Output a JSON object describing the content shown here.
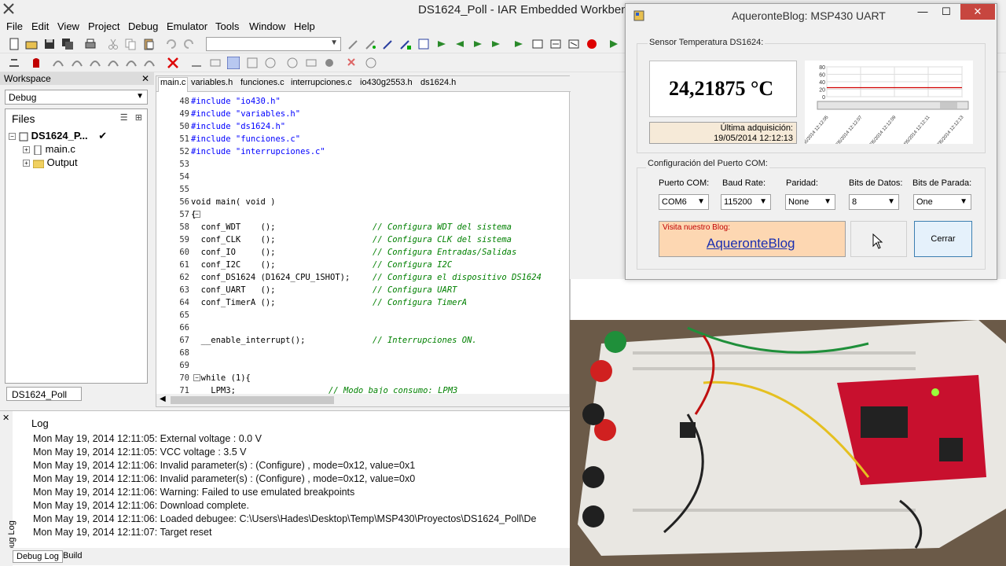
{
  "window": {
    "title": "DS1624_Poll - IAR Embedded Workbench"
  },
  "menu": [
    "File",
    "Edit",
    "View",
    "Project",
    "Debug",
    "Emulator",
    "Tools",
    "Window",
    "Help"
  ],
  "workspace": {
    "title": "Workspace",
    "config": "Debug",
    "files_header": "Files",
    "tree": [
      {
        "label": "DS1624_P...",
        "check": "✔"
      },
      {
        "label": "main.c"
      },
      {
        "label": "Output"
      }
    ],
    "bottom_tab": "DS1624_Poll"
  },
  "editor": {
    "tabs": [
      "main.c",
      "variables.h",
      "funciones.c",
      "interrupciones.c",
      "io430g2553.h",
      "ds1624.h"
    ],
    "lines": [
      {
        "n": "48",
        "t": "#include \"io430.h\""
      },
      {
        "n": "49",
        "t": "#include \"variables.h\""
      },
      {
        "n": "50",
        "t": "#include \"ds1624.h\""
      },
      {
        "n": "51",
        "t": "#include \"funciones.c\""
      },
      {
        "n": "52",
        "t": "#include \"interrupciones.c\""
      },
      {
        "n": "53",
        "t": ""
      },
      {
        "n": "54",
        "t": ""
      },
      {
        "n": "55",
        "t": ""
      },
      {
        "n": "56",
        "t": "void main( void )"
      },
      {
        "n": "57",
        "t": "{"
      },
      {
        "n": "58",
        "t": "  conf_WDT    ();",
        "c": "// Configura WDT del sistema"
      },
      {
        "n": "59",
        "t": "  conf_CLK    ();",
        "c": "// Configura CLK del sistema"
      },
      {
        "n": "60",
        "t": "  conf_IO     ();",
        "c": "// Configura Entradas/Salidas"
      },
      {
        "n": "61",
        "t": "  conf_I2C    ();",
        "c": "// Configura I2C"
      },
      {
        "n": "62",
        "t": "  conf_DS1624 (D1624_CPU_1SHOT);",
        "c": "// Configura el dispositivo DS1624"
      },
      {
        "n": "63",
        "t": "  conf_UART   ();",
        "c": "// Configura UART"
      },
      {
        "n": "64",
        "t": "  conf_TimerA ();",
        "c": "// Configura TimerA"
      },
      {
        "n": "65",
        "t": ""
      },
      {
        "n": "66",
        "t": ""
      },
      {
        "n": "67",
        "t": "  __enable_interrupt();",
        "c": "// Interrupciones ON."
      },
      {
        "n": "68",
        "t": ""
      },
      {
        "n": "69",
        "t": ""
      },
      {
        "n": "70",
        "t": "  while (1){"
      },
      {
        "n": "71",
        "t": "    LPM3;",
        "c": "// Modo bajo consumo: LPM3"
      }
    ]
  },
  "log": {
    "header": "Log",
    "side_label": "Debug Log",
    "lines": [
      "Mon May 19, 2014 12:11:05: External voltage : 0.0 V",
      "Mon May 19, 2014 12:11:05: VCC voltage : 3.5 V",
      "Mon May 19, 2014 12:11:06: Invalid parameter(s) : (Configure) , mode=0x12, value=0x1",
      "Mon May 19, 2014 12:11:06: Invalid parameter(s) : (Configure) , mode=0x12, value=0x0",
      "Mon May 19, 2014 12:11:06: Warning: Failed to use emulated breakpoints",
      "Mon May 19, 2014 12:11:06: Download complete.",
      "Mon May 19, 2014 12:11:06: Loaded debugee: C:\\Users\\Hades\\Desktop\\Temp\\MSP430\\Proyectos\\DS1624_Poll\\De",
      "Mon May 19, 2014 12:11:07: Target reset"
    ],
    "tabs": [
      "Debug Log",
      "Build"
    ]
  },
  "uart": {
    "title": "AqueronteBlog: MSP430 UART",
    "sensor_group": "Sensor Temperatura DS1624:",
    "temperature": "24,21875  °C",
    "acq_label": "Última adquisición:",
    "acq_value": "19/05/2014 12:12:13",
    "com_group": "Configuración del Puerto COM:",
    "fields": [
      {
        "label": "Puerto COM:",
        "value": "COM6"
      },
      {
        "label": "Baud Rate:",
        "value": "115200"
      },
      {
        "label": "Paridad:",
        "value": "None"
      },
      {
        "label": "Bits de Datos:",
        "value": "8"
      },
      {
        "label": "Bits de Parada:",
        "value": "One"
      }
    ],
    "blog_small": "Visita nuestro Blog:",
    "blog_link": "AqueronteBlog",
    "btn_connect": "",
    "btn_close": "Cerrar",
    "chart_ticks": [
      "80",
      "60",
      "40",
      "20",
      "0"
    ],
    "chart_times": [
      "19/05/2014 12:12:05",
      "19/05/2014 12:12:07",
      "19/05/2014 12:12:09",
      "19/05/2014 12:12:11",
      "19/05/2014 12:12:13"
    ]
  },
  "chart_data": {
    "type": "line",
    "ylim": [
      0,
      80
    ],
    "x": [
      "19/05/2014 12:12:05",
      "19/05/2014 12:12:07",
      "19/05/2014 12:12:09",
      "19/05/2014 12:12:11",
      "19/05/2014 12:12:13"
    ],
    "series": [
      {
        "values": [
          24.2,
          24.2,
          24.2,
          24.2,
          24.2
        ]
      }
    ],
    "yticks": [
      "80",
      "60",
      "40",
      "20",
      "0"
    ],
    "color": "#d00000"
  }
}
